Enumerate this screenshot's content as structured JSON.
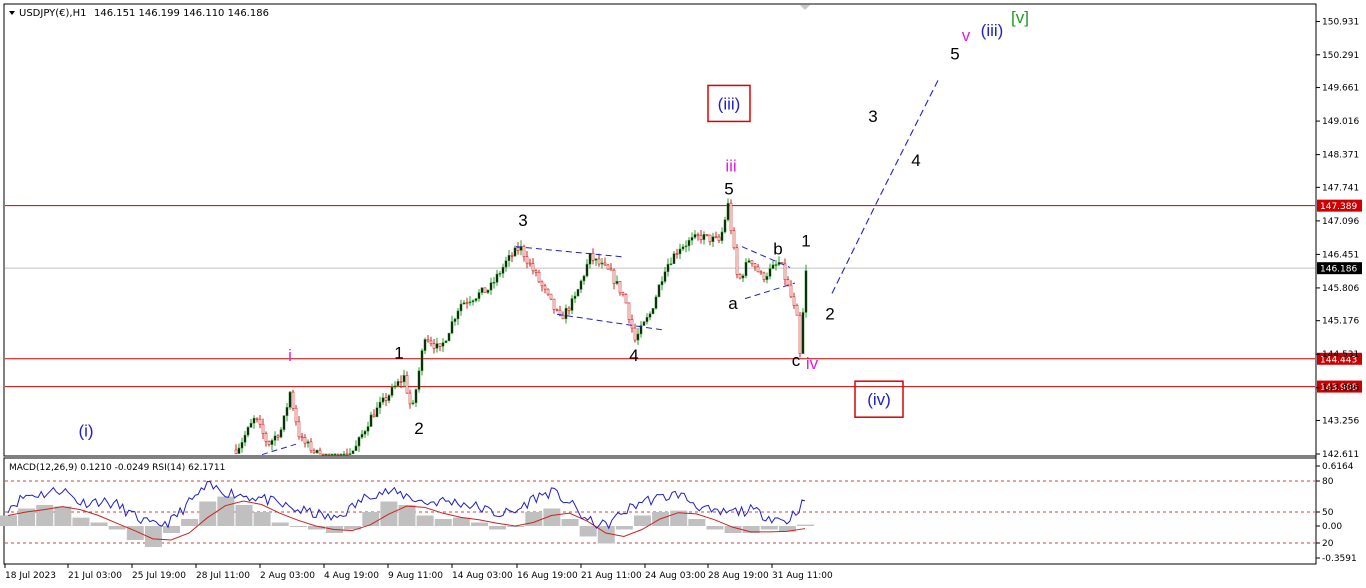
{
  "header": {
    "symbol": "USDJPY(€),H1",
    "ohlc": "146.151 146.199 146.110 146.186"
  },
  "indicator": {
    "title": "MACD(12,26,9) 0.1210 -0.0249  RSI(14) 62.1711"
  },
  "colors": {
    "up": "#2e9a2e",
    "down": "#cc2222",
    "level": "#cc0000",
    "macd": "#1f1fcc",
    "signal": "#cc2222",
    "hist": "#c0c0c0",
    "blue": "#1f1fcc",
    "magenta": "#e020e0",
    "green": "#229922",
    "black": "#000000"
  },
  "chart_data": [
    {
      "type": "candlestick",
      "y_ticks": [
        150.931,
        150.291,
        149.661,
        149.016,
        148.371,
        147.741,
        147.096,
        146.451,
        145.806,
        145.176,
        144.531,
        143.886,
        143.256,
        142.611
      ],
      "ylim": [
        142.611,
        151.23
      ],
      "x_ticks": [
        "18 Jul 2023",
        "21 Jul 03:00",
        "25 Jul 19:00",
        "28 Jul 11:00",
        "2 Aug 03:00",
        "4 Aug 19:00",
        "9 Aug 11:00",
        "14 Aug 03:00",
        "16 Aug 19:00",
        "21 Aug 11:00",
        "24 Aug 03:00",
        "28 Aug 19:00",
        "31 Aug 11:00"
      ],
      "grid": false,
      "price_levels": [
        {
          "value": 147.389,
          "label": "147.389"
        },
        {
          "value": 144.443,
          "label": "144.443"
        },
        {
          "value": 143.908,
          "label": "143.908"
        }
      ],
      "current_price": {
        "value": 146.186,
        "label": "146.186"
      },
      "price_path": [
        [
          0,
          141.9
        ],
        [
          60,
          142.2
        ],
        [
          90,
          142.4
        ],
        [
          150,
          142.0
        ],
        [
          200,
          141.9
        ],
        [
          240,
          142.8
        ],
        [
          255,
          143.3
        ],
        [
          268,
          142.8
        ],
        [
          282,
          143.1
        ],
        [
          290,
          143.8
        ],
        [
          300,
          142.9
        ],
        [
          330,
          142.4
        ],
        [
          355,
          142.7
        ],
        [
          370,
          143.3
        ],
        [
          395,
          143.9
        ],
        [
          404,
          144.1
        ],
        [
          412,
          143.4
        ],
        [
          425,
          144.9
        ],
        [
          440,
          144.6
        ],
        [
          460,
          145.5
        ],
        [
          490,
          145.8
        ],
        [
          506,
          146.3
        ],
        [
          520,
          146.6
        ],
        [
          540,
          145.9
        ],
        [
          560,
          145.2
        ],
        [
          575,
          145.6
        ],
        [
          590,
          146.4
        ],
        [
          610,
          146.1
        ],
        [
          625,
          145.6
        ],
        [
          635,
          144.8
        ],
        [
          650,
          145.3
        ],
        [
          665,
          146.2
        ],
        [
          680,
          146.6
        ],
        [
          700,
          146.8
        ],
        [
          720,
          146.7
        ],
        [
          728,
          147.4
        ],
        [
          738,
          145.9
        ],
        [
          750,
          146.4
        ],
        [
          762,
          146.0
        ],
        [
          780,
          146.3
        ],
        [
          790,
          145.7
        ],
        [
          797,
          145.2
        ],
        [
          800,
          144.5
        ],
        [
          806,
          146.1
        ]
      ],
      "trendlines": [
        {
          "from": [
            516,
            146.6
          ],
          "to": [
            625,
            146.4
          ]
        },
        {
          "from": [
            557,
            145.3
          ],
          "to": [
            662,
            145.0
          ]
        },
        {
          "from": [
            742,
            146.6
          ],
          "to": [
            790,
            146.2
          ]
        },
        {
          "from": [
            745,
            145.6
          ],
          "to": [
            795,
            145.9
          ]
        },
        {
          "from": [
            262,
            142.6
          ],
          "to": [
            296,
            142.8
          ]
        }
      ],
      "projection": [
        [
          832,
          145.7
        ],
        [
          878,
          147.5
        ],
        [
          938,
          149.8
        ]
      ],
      "wave_labels": [
        {
          "text": "(i)",
          "x": 86,
          "y": 142.95,
          "color": "#1f1fcc"
        },
        {
          "text": "i",
          "x": 290,
          "y": 144.4,
          "color": "#e020e0"
        },
        {
          "text": "1",
          "x": 399,
          "y": 144.45,
          "color": "#000000"
        },
        {
          "text": "2",
          "x": 419,
          "y": 143.0,
          "color": "#000000"
        },
        {
          "text": "3",
          "x": 523,
          "y": 147.0,
          "color": "#000000"
        },
        {
          "text": "4",
          "x": 634,
          "y": 144.4,
          "color": "#000000"
        },
        {
          "text": "5",
          "x": 729,
          "y": 147.6,
          "color": "#000000"
        },
        {
          "text": "iii",
          "x": 731,
          "y": 148.05,
          "color": "#e020e0"
        },
        {
          "text": "(iii)",
          "x": 729,
          "y": 149.24,
          "color": "#1f1fcc"
        },
        {
          "text": "a",
          "x": 733,
          "y": 145.4,
          "color": "#000000"
        },
        {
          "text": "b",
          "x": 778,
          "y": 146.45,
          "color": "#000000"
        },
        {
          "text": "1",
          "x": 806,
          "y": 146.6,
          "color": "#000000"
        },
        {
          "text": "2",
          "x": 830,
          "y": 145.2,
          "color": "#000000"
        },
        {
          "text": "c",
          "x": 796,
          "y": 144.3,
          "color": "#000000"
        },
        {
          "text": "iv",
          "x": 812,
          "y": 144.25,
          "color": "#e020e0"
        },
        {
          "text": "(iv)",
          "x": 879,
          "y": 143.55,
          "color": "#1f1fcc"
        },
        {
          "text": "3",
          "x": 873,
          "y": 149.0,
          "color": "#000000"
        },
        {
          "text": "4",
          "x": 916,
          "y": 148.15,
          "color": "#000000"
        },
        {
          "text": "5",
          "x": 955,
          "y": 150.2,
          "color": "#000000"
        },
        {
          "text": "v",
          "x": 966,
          "y": 150.56,
          "color": "#e020e0"
        },
        {
          "text": "(iii)",
          "x": 992,
          "y": 150.65,
          "color": "#1f1fcc"
        },
        {
          "text": "[v]",
          "x": 1020,
          "y": 150.9,
          "color": "#229922"
        }
      ],
      "boxed_labels": [
        "(iii)",
        "(iv)"
      ]
    },
    {
      "type": "line",
      "title": "MACD(12,26,9) 0.1210 -0.0249  RSI(14) 62.1711",
      "y_ticks": [
        "0.6164",
        "80",
        "50",
        "0.00",
        "20",
        "-0.3591"
      ],
      "ylim": [
        -0.3591,
        0.6164
      ],
      "level_lines": [
        80,
        50,
        20
      ],
      "series": [
        {
          "name": "MACD",
          "values": [
            0.15,
            0.25,
            0.3,
            0.28,
            0.12,
            0.05,
            -0.05,
            -0.2,
            -0.3,
            -0.1,
            0.1,
            0.35,
            0.42,
            0.3,
            0.2,
            0.05,
            0.0,
            -0.05,
            -0.1,
            -0.05,
            0.2,
            0.35,
            0.3,
            0.15,
            0.1,
            0.12,
            0.05,
            -0.05,
            0.0,
            0.2,
            0.25,
            0.1,
            -0.15,
            -0.25,
            -0.05,
            0.15,
            0.2,
            0.22,
            0.1,
            -0.05,
            -0.1,
            -0.1,
            -0.05,
            -0.08,
            0.02
          ]
        },
        {
          "name": "RSI",
          "values": [
            55,
            68,
            70,
            75,
            60,
            62,
            58,
            45,
            35,
            40,
            60,
            78,
            72,
            68,
            65,
            58,
            52,
            48,
            42,
            55,
            70,
            72,
            68,
            60,
            62,
            60,
            55,
            48,
            50,
            65,
            72,
            60,
            40,
            35,
            50,
            62,
            65,
            70,
            58,
            48,
            50,
            52,
            45,
            40,
            62
          ]
        }
      ]
    }
  ]
}
